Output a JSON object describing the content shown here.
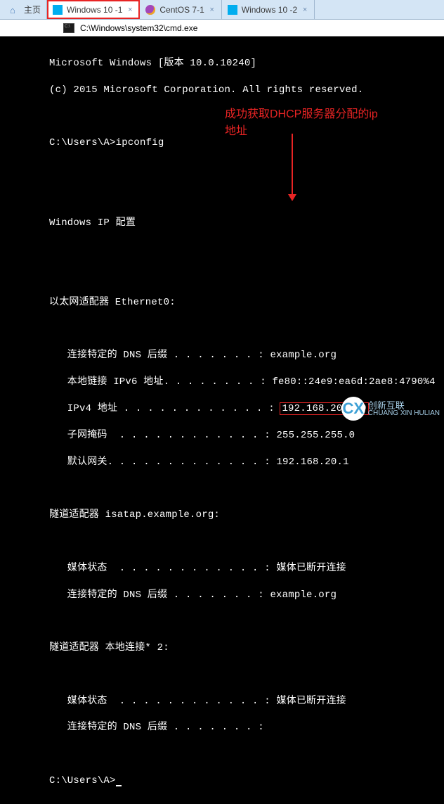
{
  "tabs": [
    {
      "label": "主页",
      "kind": "home"
    },
    {
      "label": "Windows 10 -1",
      "kind": "win"
    },
    {
      "label": "CentOS 7-1",
      "kind": "centos"
    },
    {
      "label": "Windows 10 -2",
      "kind": "win"
    }
  ],
  "title": {
    "path": "C:\\Windows\\system32\\cmd.exe"
  },
  "annotation": {
    "text": "成功获取DHCP服务器分配的ip地址"
  },
  "watermark": {
    "main": "创新互联",
    "sub": "CHUANG XIN HULIAN"
  },
  "lines": {
    "l1": "Microsoft Windows [版本 10.0.10240]",
    "l2": "(c) 2015 Microsoft Corporation. All rights reserved.",
    "l3": "",
    "l4": "C:\\Users\\A>ipconfig",
    "l5": "",
    "l6": "",
    "l7": "Windows IP 配置",
    "l8": "",
    "l9": "",
    "l10": "以太网适配器 Ethernet0:",
    "l11": "",
    "l12a": "   连接特定的 DNS 后缀 . . . . . . . : ",
    "l12b": "example.org",
    "l13a": "   本地链接 IPv6 地址. . . . . . . . : ",
    "l13b": "fe80::24e9:ea6d:2ae8:4790%4",
    "l14a": "   IPv4 地址 . . . . . . . . . . . . : ",
    "l14b": "192.168.20.129",
    "l15a": "   子网掩码  . . . . . . . . . . . . : ",
    "l15b": "255.255.255.0",
    "l16a": "   默认网关. . . . . . . . . . . . . : ",
    "l16b": "192.168.20.1",
    "l17": "",
    "l18": "隧道适配器 isatap.example.org:",
    "l19": "",
    "l20a": "   媒体状态  . . . . . . . . . . . . : ",
    "l20b": "媒体已断开连接",
    "l21a": "   连接特定的 DNS 后缀 . . . . . . . : ",
    "l21b": "example.org",
    "l22": "",
    "l23": "隧道适配器 本地连接* 2:",
    "l24": "",
    "l25a": "   媒体状态  . . . . . . . . . . . . : ",
    "l25b": "媒体已断开连接",
    "l26a": "   连接特定的 DNS 后缀 . . . . . . . : ",
    "l26b": "",
    "l27": "",
    "l28": "C:\\Users\\A>"
  }
}
